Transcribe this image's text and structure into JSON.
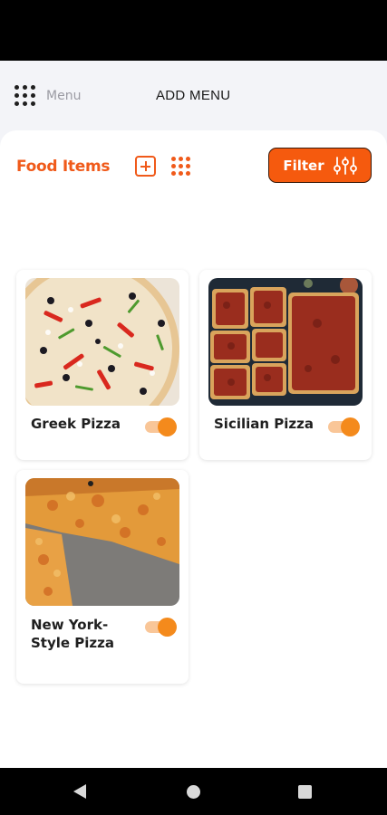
{
  "header": {
    "menu_label": "Menu",
    "title": "ADD MENU"
  },
  "section": {
    "title": "Food Items",
    "filter_label": "Filter"
  },
  "items": [
    {
      "name": "Greek Pizza",
      "enabled": true,
      "image": "greek-pizza-photo"
    },
    {
      "name": "Sicilian Pizza",
      "enabled": true,
      "image": "sicilian-pizza-photo"
    },
    {
      "name": "New York-Style Pizza",
      "enabled": true,
      "image": "new-york-style-pizza-photo"
    }
  ],
  "colors": {
    "accent": "#f05a1a",
    "filter_button": "#f55a0e",
    "toggle_knob": "#f48a1c",
    "toggle_track": "#f9c698",
    "background": "#f3f4f8"
  },
  "icons": [
    "menu-grid-icon",
    "add-icon",
    "grid-view-icon",
    "sliders-icon",
    "back-icon",
    "home-icon",
    "recent-apps-icon"
  ]
}
